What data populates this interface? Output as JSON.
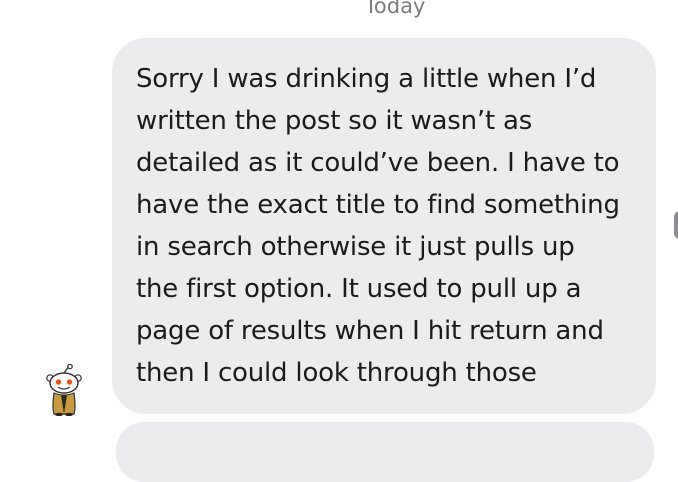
{
  "thread": {
    "date_separator": "Today"
  },
  "message": {
    "text": "Sorry I was drinking a little when I’d\nwritten the post so it wasn’t as\ndetailed as it could’ve been. I have to\nhave the exact title to find something\nin search otherwise it just pulls up\nthe first option. It used to pull up a\npage of results when I hit return and\nthen I could look through those",
    "sender_avatar_icon": "snoo-avatar-icon"
  },
  "colors": {
    "bubble_bg": "#ececef",
    "text": "#1b1b1f",
    "date_text": "#7c7c83",
    "background": "#ffffff"
  }
}
